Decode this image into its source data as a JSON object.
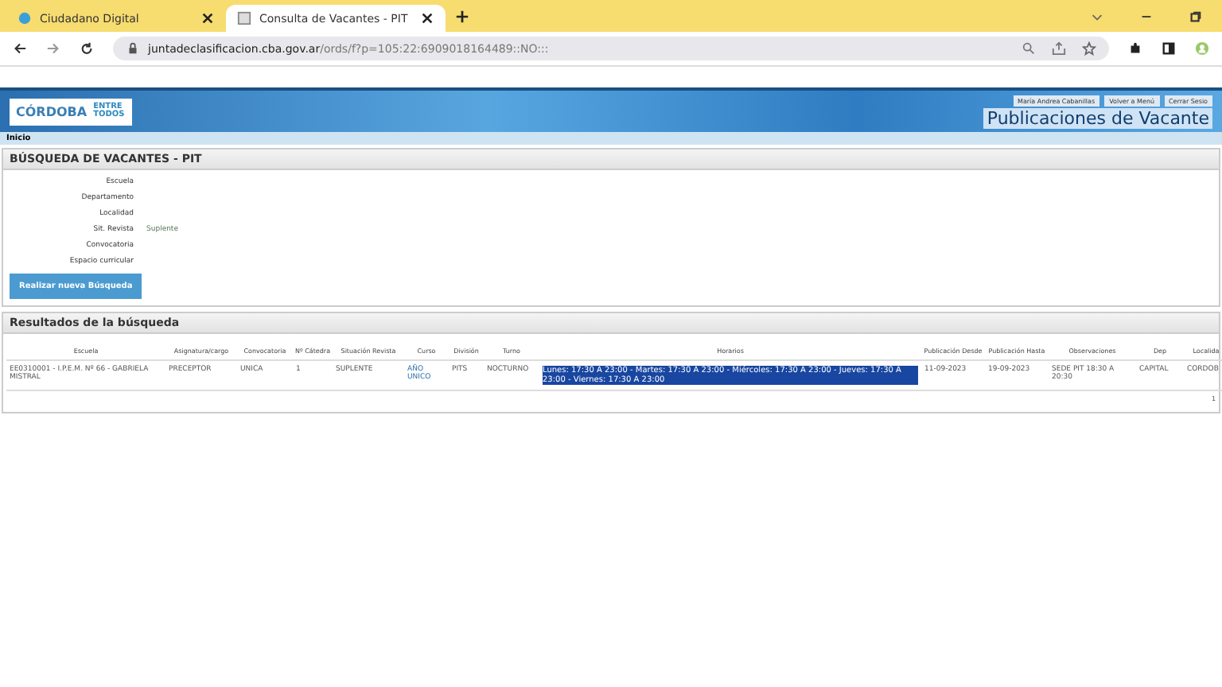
{
  "browser": {
    "tabs": [
      {
        "title": "Ciudadano Digital",
        "selected": false
      },
      {
        "title": "Consulta de Vacantes - PIT",
        "selected": true
      }
    ],
    "url": "juntadeclasificacion.cba.gov.ar",
    "url_path": "/ords/f?p=105:22:6909018164489::NO:::"
  },
  "header": {
    "logo_left": "CÓRDOBA",
    "logo_right": "ENTRE TODOS",
    "user": "María Andrea Cabanillas",
    "links": [
      "Volver a Menú",
      "Cerrar Sesio"
    ],
    "title": "Publicaciones de Vacante"
  },
  "breadcrumb": "Inicio",
  "search": {
    "title": "BÚSQUEDA DE VACANTES - PIT",
    "fields": [
      {
        "label": "Escuela"
      },
      {
        "label": "Departamento"
      },
      {
        "label": "Localidad"
      },
      {
        "label": "Sit. Revista",
        "value": "Suplente"
      },
      {
        "label": "Convocatoria"
      },
      {
        "label": "Espacio curricular"
      }
    ],
    "button": "Realizar nueva Búsqueda"
  },
  "results": {
    "title": "Resultados de la búsqueda",
    "columns": [
      "Escuela",
      "Asignatura/cargo",
      "Convocatoria",
      "Nº Cátedra",
      "Situación Revista",
      "Curso",
      "División",
      "Turno",
      "Horarios",
      "Publicación Desde",
      "Publicación Hasta",
      "Observaciones",
      "Dep",
      "Localida"
    ],
    "rows": [
      {
        "cells": [
          "EE0310001 - I.P.E.M. Nº 66 - GABRIELA MISTRAL",
          "PRECEPTOR",
          "UNICA",
          "1",
          "SUPLENTE",
          "AÑO UNICO",
          "PITS",
          "NOCTURNO",
          "Lunes: 17:30 A 23:00 - Martes: 17:30 A 23:00 - Miércoles: 17:30 A 23:00 - Jueves: 17:30 A 23:00 - Viernes: 17:30 A 23:00",
          "11-09-2023",
          "19-09-2023",
          "SEDE PIT 18:30 A 20:30",
          "CAPITAL",
          "CORDOB"
        ],
        "horarios_highlighted": true
      }
    ],
    "pagination": "1"
  }
}
